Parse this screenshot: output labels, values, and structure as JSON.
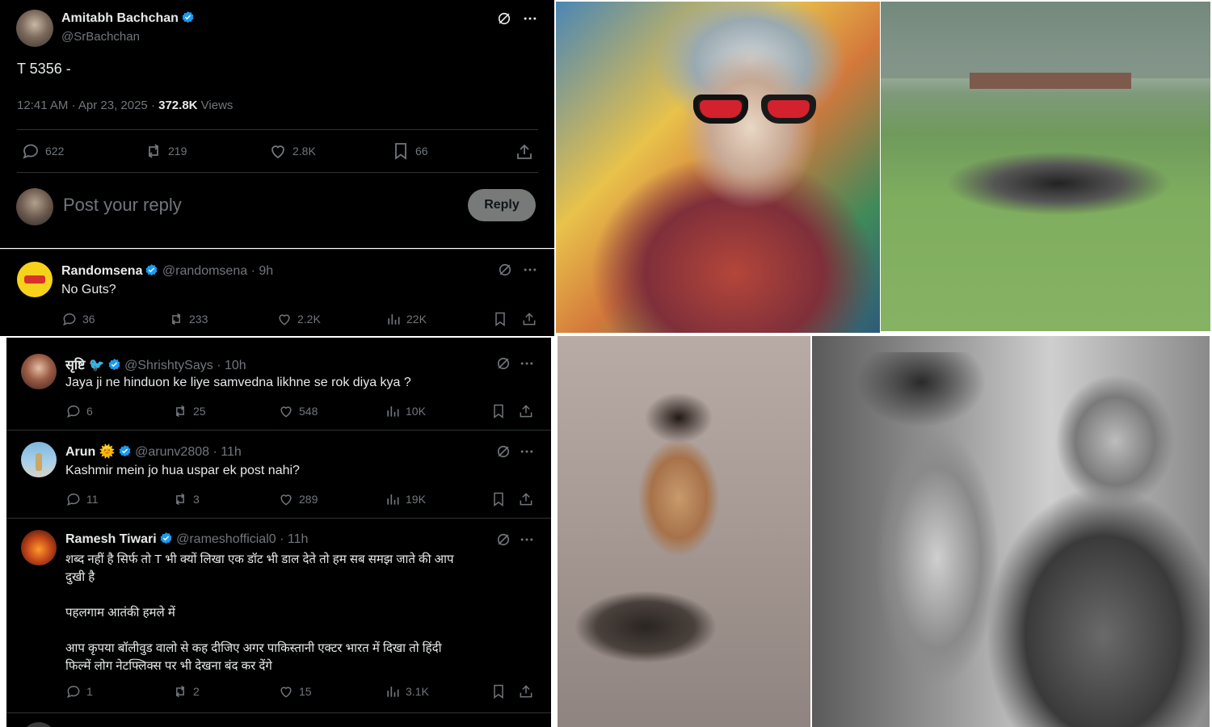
{
  "main_tweet": {
    "author_name": "Amitabh Bachchan",
    "handle": "@SrBachchan",
    "text": "T 5356 -",
    "time": "12:41 AM · Apr 23, 2025",
    "views_count": "372.8K",
    "views_label": "Views",
    "stats": {
      "replies": "622",
      "reposts": "219",
      "likes": "2.8K",
      "bookmarks": "66"
    },
    "reply_placeholder": "Post your reply",
    "reply_button": "Reply"
  },
  "replies": [
    {
      "name": "Randomsena",
      "handle": "@randomsena",
      "age": "· 9h",
      "text": "No Guts?",
      "stats": {
        "replies": "36",
        "reposts": "233",
        "likes": "2.2K",
        "views": "22K"
      }
    },
    {
      "name": "सृष्टि 🐦",
      "handle": "@ShrishtySays",
      "age": "· 10h",
      "text": "Jaya ji ne hinduon ke liye samvedna likhne se rok diya kya ?",
      "stats": {
        "replies": "6",
        "reposts": "25",
        "likes": "548",
        "views": "10K"
      }
    },
    {
      "name": "Arun 🌞",
      "handle": "@arunv2808",
      "age": "· 11h",
      "text": "Kashmir mein jo hua uspar ek post nahi?",
      "stats": {
        "replies": "11",
        "reposts": "3",
        "likes": "289",
        "views": "19K"
      }
    },
    {
      "name": "Ramesh Tiwari",
      "handle": "@rameshofficial0",
      "age": "· 11h",
      "text_line1": "शब्द नहीं है सिर्फ तो T भी क्यों लिखा एक डॉट भी डाल देते तो हम सब समझ जाते की आप",
      "text_line2": "दुखी है",
      "text_line3": "पहलगाम आतंकी हमले में",
      "text_line4": "आप कृपया बॉलीवुड वालो से कह दीजिए अगर पाकिस्तानी एक्टर भारत में दिखा तो हिंदी",
      "text_line5": "फिल्में लोग नेटफ्लिक्स पर भी देखना बंद कर देंगे",
      "stats": {
        "replies": "1",
        "reposts": "2",
        "likes": "15",
        "views": "3.1K"
      }
    }
  ],
  "colors": {
    "background": "#000000",
    "text": "#e7e9ea",
    "muted": "#71767b",
    "verified": "#1d9bf0",
    "reply_button_bg": "#787a7a",
    "divider": "#2f3336"
  },
  "icons": [
    "grok-icon",
    "more-icon",
    "reply-icon",
    "repost-icon",
    "like-icon",
    "bookmark-icon",
    "views-icon",
    "share-icon",
    "verified-badge-icon"
  ]
}
